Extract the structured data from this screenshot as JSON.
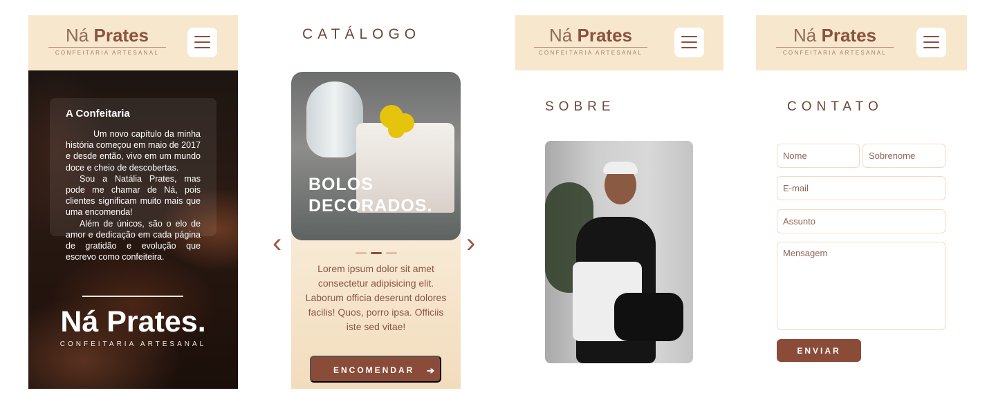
{
  "brand": {
    "name_light": "Ná",
    "name_bold": "Prates",
    "subtitle": "CONFEITARIA ARTESANAL"
  },
  "colors": {
    "header_bg": "#f7e7cc",
    "accent": "#8a4c38",
    "text_brown": "#6e4436"
  },
  "icons": {
    "menu": "hamburger-menu-icon",
    "prev": "chevron-left-icon",
    "next": "chevron-right-icon",
    "arrow": "arrow-right-icon"
  },
  "home": {
    "about_title": "A Confeitaria",
    "about_paragraphs": [
      "Um novo capítulo da minha história começou em maio de 2017 e desde então, vivo em um mundo doce e cheio de descobertas.",
      "Sou a Natália Prates, mas pode me chamar de Ná, pois clientes significam muito mais que uma encomenda!",
      "Além de únicos, são o elo de amor e dedicação em cada página de gratidão e evolução que escrevo como confeiteira."
    ],
    "hero_name": "Ná Prates.",
    "hero_subtitle": "CONFEITARIA ARTESANAL"
  },
  "catalog": {
    "title": "CATÁLOGO",
    "slide_caption_line1": "BOLOS",
    "slide_caption_line2": "DECORADOS.",
    "slide_count": 3,
    "active_slide": 2,
    "description": "Lorem ipsum dolor sit amet consectetur adipisicing elit. Laborum officia deserunt dolores facilis! Quos, porro ipsa. Officiis iste sed vitae!",
    "order_label": "ENCOMENDAR",
    "order_arrow": "➔",
    "prev_glyph": "‹",
    "next_glyph": "›"
  },
  "sobre": {
    "title": "SOBRE"
  },
  "contato": {
    "title": "CONTATO",
    "first_name_placeholder": "Nome",
    "last_name_placeholder": "Sobrenome",
    "email_placeholder": "E-mail",
    "subject_placeholder": "Assunto",
    "message_placeholder": "Mensagem",
    "send_label": "ENVIAR"
  }
}
